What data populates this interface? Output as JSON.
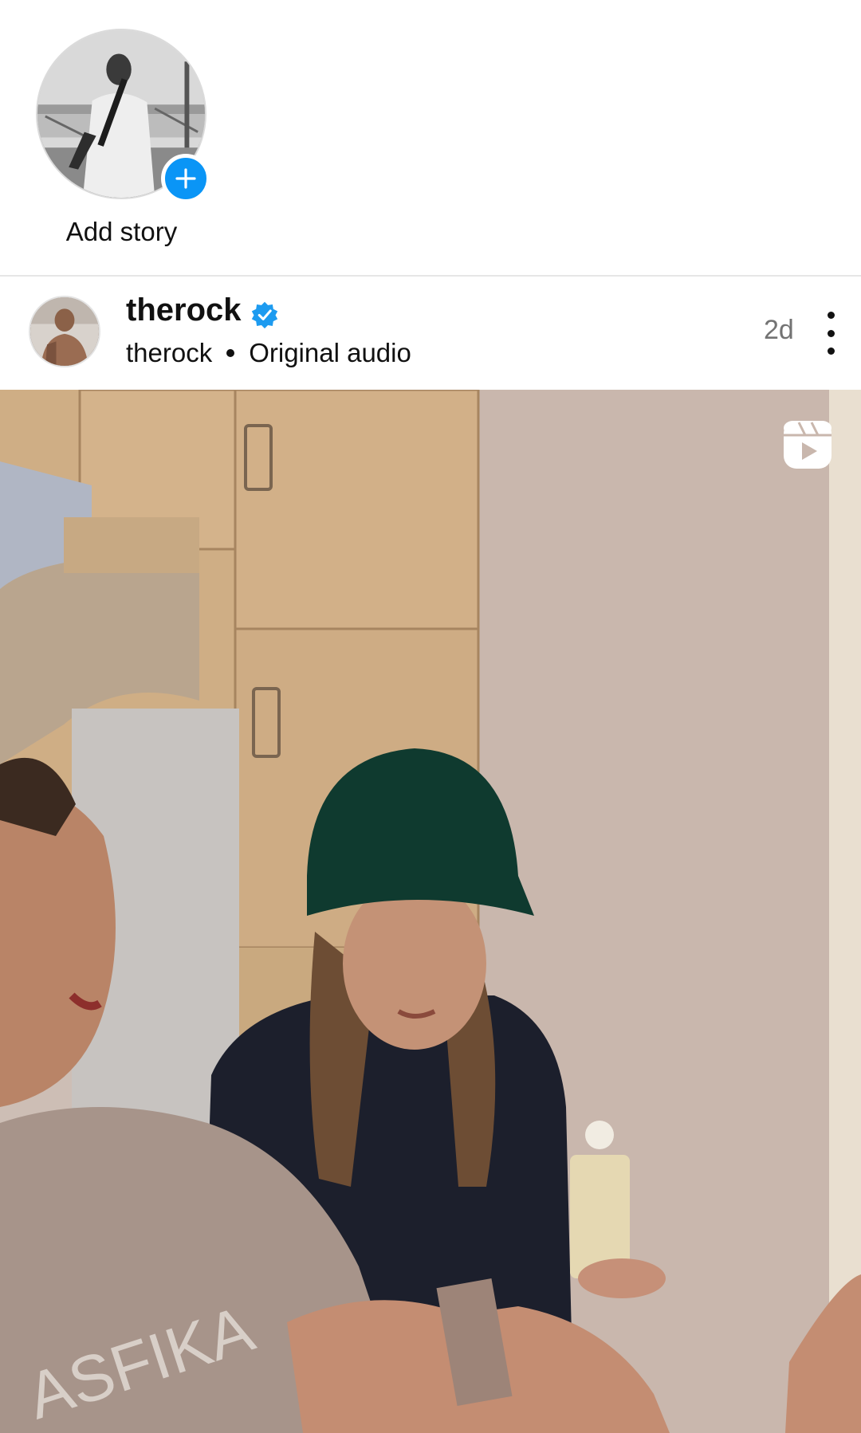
{
  "stories": {
    "own": {
      "label": "Add story",
      "avatar_icon": "profile-photo",
      "badge_icon": "plus-icon",
      "badge_color": "#0a95f6"
    }
  },
  "post": {
    "username": "therock",
    "verified_icon": "verified-badge-icon",
    "verified_color": "#1d9bf0",
    "audio_owner": "therock",
    "audio_label": "Original audio",
    "timestamp": "2d",
    "more_icon": "more-vertical-icon",
    "media_type_icon": "reels-icon",
    "media_overlay_text": "ASFIKA"
  }
}
